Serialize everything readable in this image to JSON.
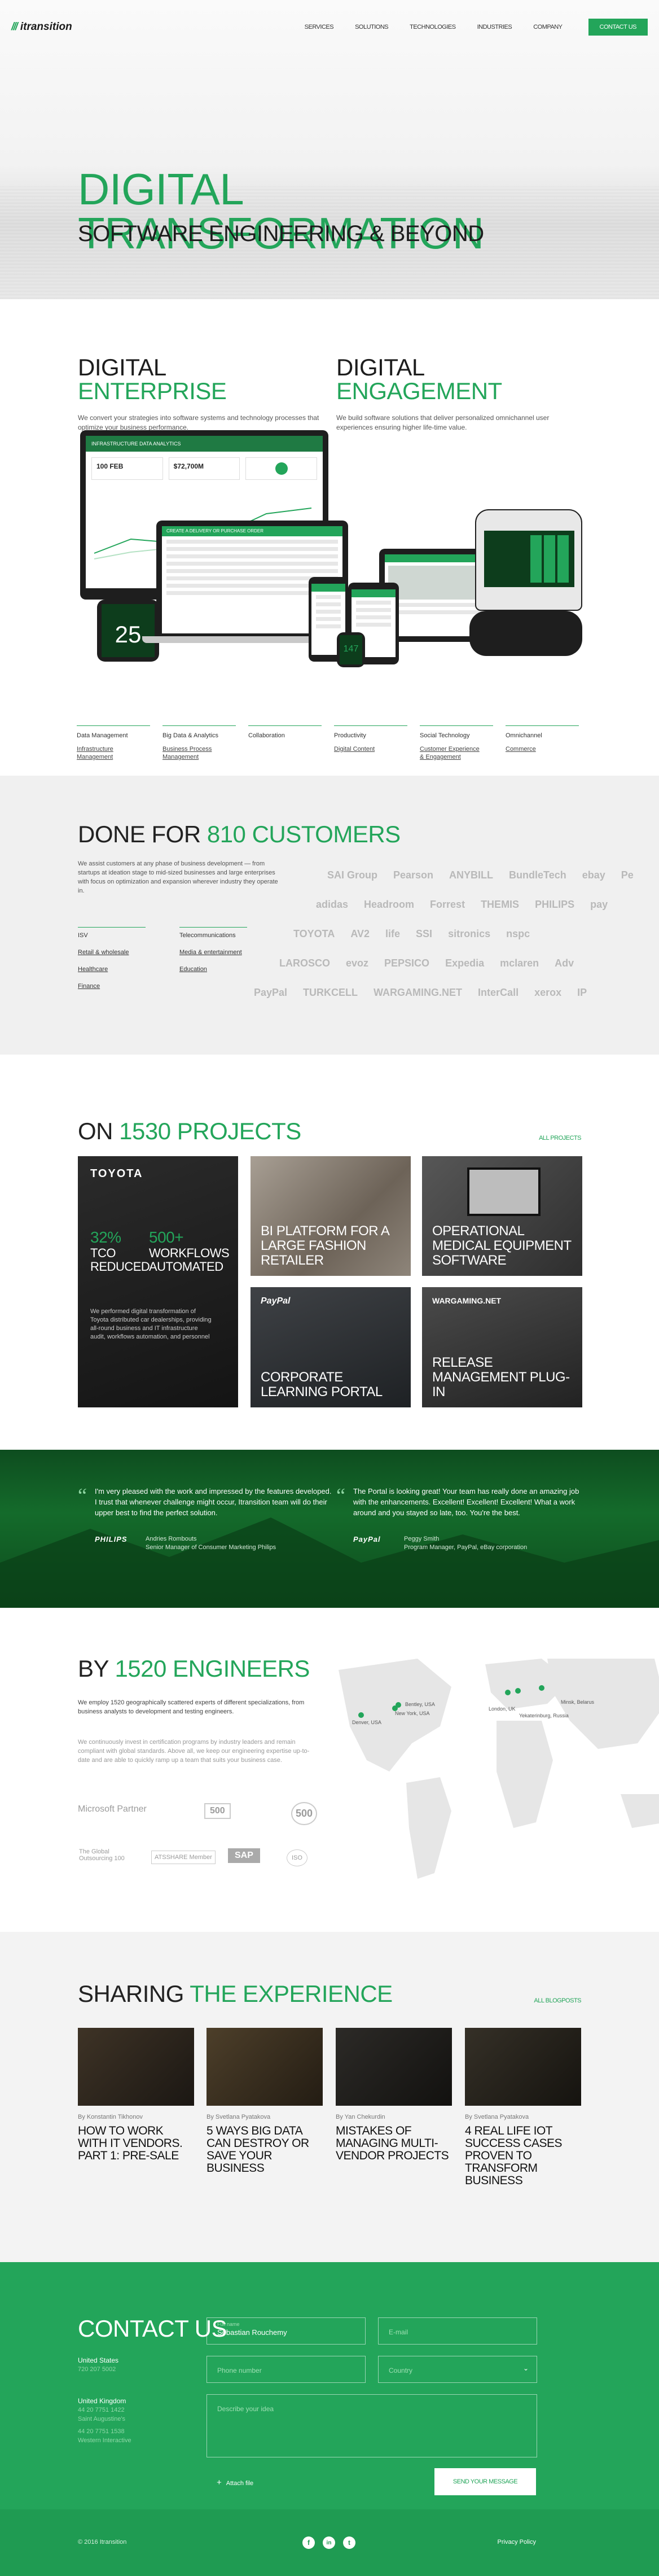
{
  "header": {
    "logo": "itransition",
    "logo_bars": "///",
    "nav": [
      "SERVICES",
      "SOLUTIONS",
      "TECHNOLOGIES",
      "INDUSTRIES",
      "COMPANY"
    ],
    "cta": "CONTACT US"
  },
  "hero": {
    "title": "DIGITAL TRANSFORMATION",
    "subtitle": "SOFTWARE ENGINEERING & BEYOND"
  },
  "digital": {
    "enterprise": {
      "w1": "DIGITAL",
      "w2": "ENTERPRISE",
      "text": "We convert your strategies into software systems and technology processes that optimize your business performance."
    },
    "engagement": {
      "w1": "DIGITAL",
      "w2": "ENGAGEMENT",
      "text": "We build software solutions that deliver personalized omnichannel user experiences ensuring higher life-time value."
    },
    "screens": {
      "dashboard": "INFRASTRUCTURE DATA ANALYTICS",
      "kpi1": "100 FEB",
      "kpi2": "$72,700M",
      "tablet": "CREATE A DELIVERY OR PURCHASE ORDER",
      "watch": "147",
      "thermo": "25"
    },
    "capabilities": [
      {
        "label": "Data Management",
        "link1": "Infrastructure",
        "link2": "Management"
      },
      {
        "label": "Big Data & Analytics",
        "link1": "Business Process",
        "link2": "Management"
      },
      {
        "label": "Collaboration",
        "link1": "",
        "link2": ""
      },
      {
        "label": "Productivity",
        "link1": "Digital Content",
        "link2": ""
      },
      {
        "label": "Social Technology",
        "link1": "Customer Experience",
        "link2": "& Engagement"
      },
      {
        "label": "Omnichannel",
        "link1": "Commerce",
        "link2": ""
      }
    ]
  },
  "customers": {
    "w1": "DONE FOR",
    "w2": "810 CUSTOMERS",
    "text": "We assist customers at any phase of business development — from startups at ideation stage to mid-sized businesses and large enterprises with focus on optimization and expansion wherever industry they operate in.",
    "industries_col1": [
      "ISV",
      "Retail & wholesale",
      "Healthcare",
      "Finance"
    ],
    "industries_col2": [
      "Telecommunications",
      "Media & entertainment",
      "Education"
    ],
    "logos": [
      [
        "SAI Group",
        "Pearson",
        "ANYBILL",
        "BundleTech",
        "ebay",
        "Pe"
      ],
      [
        "adidas",
        "Headroom",
        "Forrest",
        "THEMIS",
        "PHILIPS",
        "pay"
      ],
      [
        "TOYOTA",
        "AV2",
        "life",
        "SSI",
        "sitronics",
        "nspc"
      ],
      [
        "LAROSCO",
        "evoz",
        "PEPSICO",
        "Expedia",
        "mclaren",
        "Adv"
      ],
      [
        "PayPal",
        "TURKCELL",
        "WARGAMING.NET",
        "InterCall",
        "xerox",
        "IP"
      ]
    ]
  },
  "projects": {
    "w1": "ON",
    "w2": "1530 PROJECTS",
    "all": "ALL PROJECTS",
    "toyota": {
      "brand": "TOYOTA",
      "stat1": "32%",
      "stat1_label": "TCO REDUCED",
      "stat2": "500+",
      "stat2_label": "WORKFLOWS AUTOMATED",
      "text": "We performed digital transformation of Toyota distributed car dealerships, providing all-round business and IT infrastructure audit, workflows automation, and personnel"
    },
    "items": [
      {
        "title": "BI PLATFORM FOR A LARGE FASHION RETAILER",
        "brand": ""
      },
      {
        "title": "OPERATIONAL MEDICAL EQUIPMENT SOFTWARE",
        "brand": ""
      },
      {
        "title": "CORPORATE LEARNING PORTAL",
        "brand": "PayPal"
      },
      {
        "title": "RELEASE MANAGEMENT PLUG-IN",
        "brand": "WARGAMING.NET"
      }
    ]
  },
  "testimonials": [
    {
      "text": "I'm very pleased with the work and impressed by the features developed. I trust that whenever challenge might occur, Itransition team will do their upper best to find the perfect solution.",
      "brand": "PHILIPS",
      "name": "Andries Rombouts",
      "role": "Senior Manager of Consumer Marketing Philips"
    },
    {
      "text": "The Portal is looking great! Your team has really done an amazing job with the enhancements. Excellent! Excellent! Excellent! What a work around and you stayed so late, too. You're the best.",
      "brand": "PayPal",
      "name": "Peggy Smith",
      "role": "Program Manager, PayPal, eBay corporation"
    }
  ],
  "engineers": {
    "w1": "BY",
    "w2": "1520 ENGINEERS",
    "text1": "We employ 1520 geographically scattered experts of different specializations, from business analysts to development and testing engineers.",
    "text2": "We continuously invest in certification programs by industry leaders and remain compliant with global standards. Above all, we keep our engineering expertise up-to-date and are able to quickly ramp up a team that suits your business case.",
    "offices": [
      "Denver, USA",
      "New York, USA",
      "Bentley, USA",
      "London, UK",
      "Minsk, Belarus",
      "Yekaterinburg, Russia"
    ],
    "partners": [
      "Microsoft Partner",
      "500",
      "500",
      "The Global Outsourcing 100",
      "ATSSHARE Member",
      "SAP",
      "ISO"
    ]
  },
  "blog": {
    "w1": "SHARING",
    "w2": "THE EXPERIENCE",
    "all": "ALL BLOGPOSTS",
    "posts": [
      {
        "by": "By Konstantin Tikhonov",
        "title": "HOW TO WORK WITH IT VENDORS. PART 1: PRE-SALE"
      },
      {
        "by": "By Svetlana Pyatakova",
        "title": "5 WAYS BIG DATA CAN DESTROY OR SAVE YOUR BUSINESS"
      },
      {
        "by": "By Yan Chekurdin",
        "title": "MISTAKES OF MANAGING MULTI-VENDOR PROJECTS"
      },
      {
        "by": "By Svetlana Pyatakova",
        "title": "4 REAL LIFE IOT SUCCESS CASES PROVEN TO TRANSFORM BUSINESS"
      }
    ]
  },
  "contact": {
    "title": "CONTACT US",
    "offices": [
      {
        "country": "United States",
        "line1": "720 207 5002",
        "line2": ""
      },
      {
        "country": "United Kingdom",
        "line1": "44 20 7751 1422",
        "line2": "Saint Augustine's"
      },
      {
        "country": "",
        "line1": "44 20 7751 1538",
        "line2": "Western Interactive"
      }
    ],
    "form": {
      "name_label": "Full name",
      "name_value": "Sebastian Rouchemy",
      "email": "E-mail",
      "phone": "Phone number",
      "country": "Country",
      "idea": "Describe your idea",
      "attach": "Attach file",
      "send": "SEND YOUR MESSAGE"
    }
  },
  "footer": {
    "copyright": "© 2016 Itransition",
    "social": [
      "f",
      "in",
      "t"
    ],
    "privacy": "Privacy Policy"
  },
  "colors": {
    "brand": "#23a55a",
    "dark_green": "#0e4d1f"
  }
}
